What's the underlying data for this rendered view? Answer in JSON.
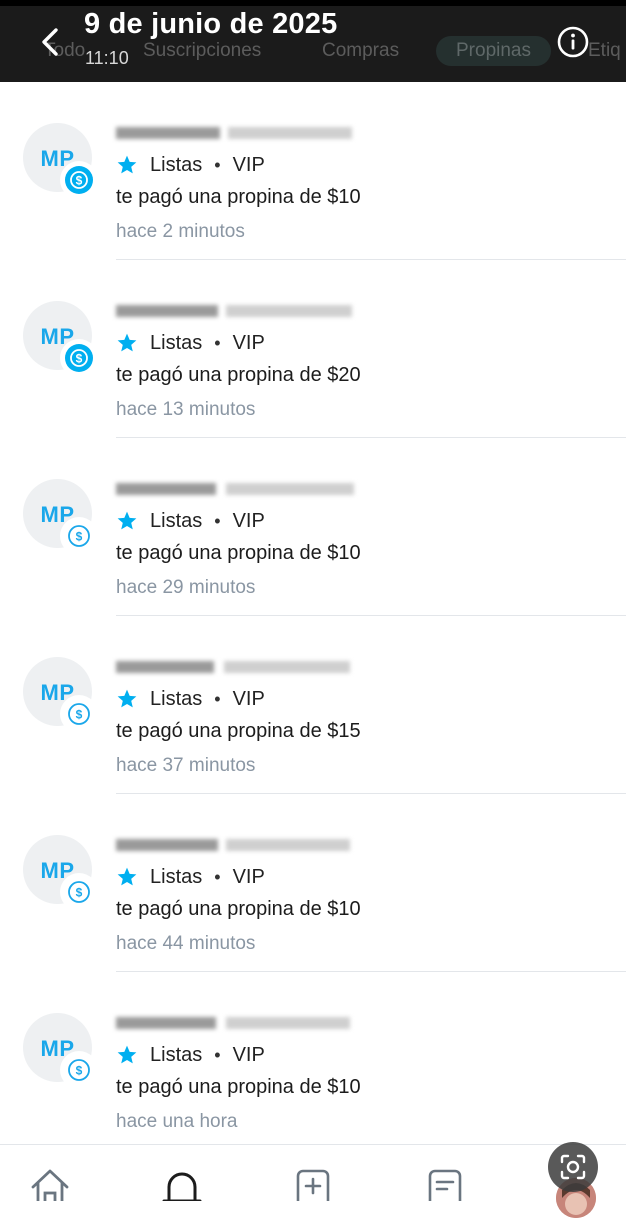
{
  "header": {
    "date_title": "9 de junio de 2025",
    "time": "11:10",
    "tabs": [
      "Todo",
      "Suscripciones",
      "Compras",
      "Propinas",
      "Etiq"
    ],
    "active_tab": "Propinas"
  },
  "notifications": [
    {
      "initials": "MP",
      "list_label": "Listas",
      "tag": "VIP",
      "message": "te pagó una propina de $10",
      "time_ago": "hace 2 minutos",
      "badge_style": "filled"
    },
    {
      "initials": "MP",
      "list_label": "Listas",
      "tag": "VIP",
      "message": "te pagó una propina de $20",
      "time_ago": "hace 13 minutos",
      "badge_style": "filled"
    },
    {
      "initials": "MP",
      "list_label": "Listas",
      "tag": "VIP",
      "message": "te pagó una propina de $10",
      "time_ago": "hace 29 minutos",
      "badge_style": "outline"
    },
    {
      "initials": "MP",
      "list_label": "Listas",
      "tag": "VIP",
      "message": "te pagó una propina de $15",
      "time_ago": "hace 37 minutos",
      "badge_style": "outline"
    },
    {
      "initials": "MP",
      "list_label": "Listas",
      "tag": "VIP",
      "message": "te pagó una propina de $10",
      "time_ago": "hace 44 minutos",
      "badge_style": "outline"
    },
    {
      "initials": "MP",
      "list_label": "Listas",
      "tag": "VIP",
      "message": "te pagó una propina de $10",
      "time_ago": "hace una hora",
      "badge_style": "outline"
    }
  ],
  "bottom_nav": [
    "home-icon",
    "bell-icon",
    "add-post-icon",
    "messages-icon",
    "profile-avatar"
  ],
  "colors": {
    "accent": "#00aff0",
    "initials": "#1aa7ea",
    "header_bg": "#1b1b1b",
    "muted_text": "#8a96a3"
  }
}
